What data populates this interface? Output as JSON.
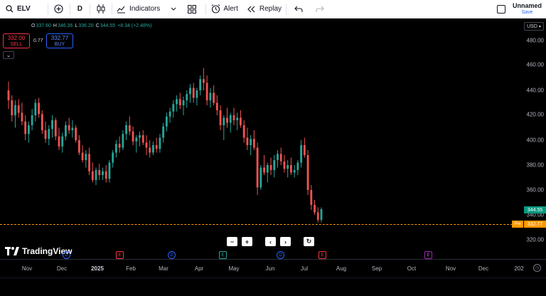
{
  "toolbar": {
    "symbol": "ELV",
    "interval": "D",
    "indicators_label": "Indicators",
    "alert_label": "Alert",
    "replay_label": "Replay",
    "layout_name": "Unnamed",
    "save_label": "Save"
  },
  "legend": {
    "o_key": "O",
    "o_val": "337.60",
    "h_key": "H",
    "h_val": "346.36",
    "l_key": "L",
    "l_val": "336.20",
    "c_key": "C",
    "c_val": "344.55",
    "change": "+8.34 (+2.48%)"
  },
  "trade": {
    "sell_price": "332.00",
    "sell_label": "SELL",
    "spread": "0.77",
    "buy_price": "332.77",
    "buy_label": "BUY"
  },
  "price_scale": {
    "currency": "USD",
    "ticks": [
      "480.00",
      "460.00",
      "440.00",
      "420.00",
      "400.00",
      "380.00",
      "360.00",
      "340.00",
      "320.00"
    ],
    "last_price": "344.55",
    "pre_label": "Pre",
    "pre_price": "332.77"
  },
  "time_axis": {
    "labels": [
      "Nov",
      "Dec",
      "2025",
      "Feb",
      "Mar",
      "Apr",
      "May",
      "Jun",
      "Jul",
      "Aug",
      "Sep",
      "Oct",
      "Nov",
      "Dec",
      "202"
    ]
  },
  "events": [
    "E",
    "D",
    "E",
    "D",
    "E",
    "D",
    "E",
    "E"
  ],
  "brand": "TradingView",
  "colors": {
    "up": "#26a69a",
    "down": "#ef5350",
    "pre": "#ff9800",
    "background": "#000000"
  },
  "chart_data": {
    "type": "candlestick",
    "ylim": [
      310,
      490
    ],
    "series": [
      {
        "values": [
          [
            440,
            447,
            425,
            432
          ],
          [
            432,
            436,
            415,
            420
          ],
          [
            420,
            432,
            410,
            428
          ],
          [
            428,
            433,
            418,
            422
          ],
          [
            422,
            430,
            412,
            415
          ],
          [
            415,
            420,
            400,
            405
          ],
          [
            405,
            415,
            398,
            412
          ],
          [
            412,
            425,
            408,
            420
          ],
          [
            420,
            433,
            415,
            430
          ],
          [
            430,
            434,
            418,
            421
          ],
          [
            421,
            424,
            405,
            408
          ],
          [
            408,
            415,
            398,
            401
          ],
          [
            401,
            412,
            396,
            409
          ],
          [
            409,
            420,
            402,
            416
          ],
          [
            416,
            418,
            400,
            403
          ],
          [
            403,
            410,
            392,
            395
          ],
          [
            395,
            406,
            390,
            403
          ],
          [
            403,
            415,
            400,
            412
          ],
          [
            412,
            418,
            405,
            408
          ],
          [
            408,
            416,
            402,
            410
          ],
          [
            410,
            412,
            398,
            400
          ],
          [
            400,
            404,
            388,
            390
          ],
          [
            390,
            396,
            382,
            384
          ],
          [
            384,
            392,
            378,
            389
          ],
          [
            389,
            394,
            372,
            375
          ],
          [
            375,
            382,
            366,
            368
          ],
          [
            368,
            378,
            364,
            376
          ],
          [
            376,
            381,
            368,
            372
          ],
          [
            372,
            378,
            368,
            375
          ],
          [
            375,
            380,
            366,
            369
          ],
          [
            369,
            384,
            366,
            382
          ],
          [
            382,
            392,
            378,
            390
          ],
          [
            390,
            400,
            386,
            397
          ],
          [
            397,
            403,
            390,
            394
          ],
          [
            394,
            408,
            392,
            405
          ],
          [
            405,
            415,
            400,
            412
          ],
          [
            412,
            419,
            404,
            407
          ],
          [
            407,
            411,
            396,
            399
          ],
          [
            399,
            404,
            390,
            402
          ],
          [
            402,
            407,
            395,
            404
          ],
          [
            404,
            408,
            396,
            398
          ],
          [
            398,
            404,
            388,
            394
          ],
          [
            394,
            400,
            386,
            390
          ],
          [
            390,
            399,
            388,
            396
          ],
          [
            396,
            402,
            390,
            393
          ],
          [
            393,
            405,
            390,
            402
          ],
          [
            402,
            414,
            398,
            411
          ],
          [
            411,
            422,
            407,
            419
          ],
          [
            419,
            426,
            414,
            423
          ],
          [
            423,
            432,
            418,
            429
          ],
          [
            429,
            436,
            423,
            433
          ],
          [
            433,
            438,
            425,
            428
          ],
          [
            428,
            435,
            420,
            432
          ],
          [
            432,
            440,
            426,
            437
          ],
          [
            437,
            445,
            430,
            442
          ],
          [
            442,
            446,
            430,
            434
          ],
          [
            434,
            442,
            428,
            440
          ],
          [
            440,
            452,
            436,
            449
          ],
          [
            449,
            458,
            440,
            446
          ],
          [
            446,
            452,
            428,
            432
          ],
          [
            432,
            442,
            426,
            438
          ],
          [
            438,
            444,
            428,
            430
          ],
          [
            430,
            436,
            420,
            424
          ],
          [
            424,
            428,
            408,
            412
          ],
          [
            412,
            420,
            400,
            418
          ],
          [
            418,
            426,
            410,
            414
          ],
          [
            414,
            422,
            406,
            420
          ],
          [
            420,
            426,
            412,
            416
          ],
          [
            416,
            422,
            408,
            418
          ],
          [
            418,
            424,
            410,
            412
          ],
          [
            412,
            416,
            398,
            402
          ],
          [
            402,
            410,
            392,
            396
          ],
          [
            396,
            404,
            388,
            401
          ],
          [
            401,
            408,
            392,
            394
          ],
          [
            394,
            398,
            356,
            362
          ],
          [
            362,
            380,
            360,
            378
          ],
          [
            378,
            388,
            372,
            374
          ],
          [
            374,
            382,
            366,
            380
          ],
          [
            380,
            386,
            372,
            376
          ],
          [
            376,
            388,
            370,
            384
          ],
          [
            384,
            392,
            378,
            389
          ],
          [
            389,
            394,
            380,
            383
          ],
          [
            383,
            388,
            374,
            377
          ],
          [
            377,
            384,
            370,
            380
          ],
          [
            380,
            386,
            372,
            374
          ],
          [
            374,
            380,
            370,
            376
          ],
          [
            376,
            384,
            372,
            382
          ],
          [
            382,
            400,
            378,
            396
          ],
          [
            396,
            402,
            386,
            388
          ],
          [
            388,
            392,
            356,
            360
          ],
          [
            360,
            364,
            344,
            348
          ],
          [
            348,
            352,
            340,
            342
          ],
          [
            342,
            346,
            334,
            336
          ],
          [
            336,
            346,
            334,
            344.55
          ]
        ]
      }
    ]
  }
}
